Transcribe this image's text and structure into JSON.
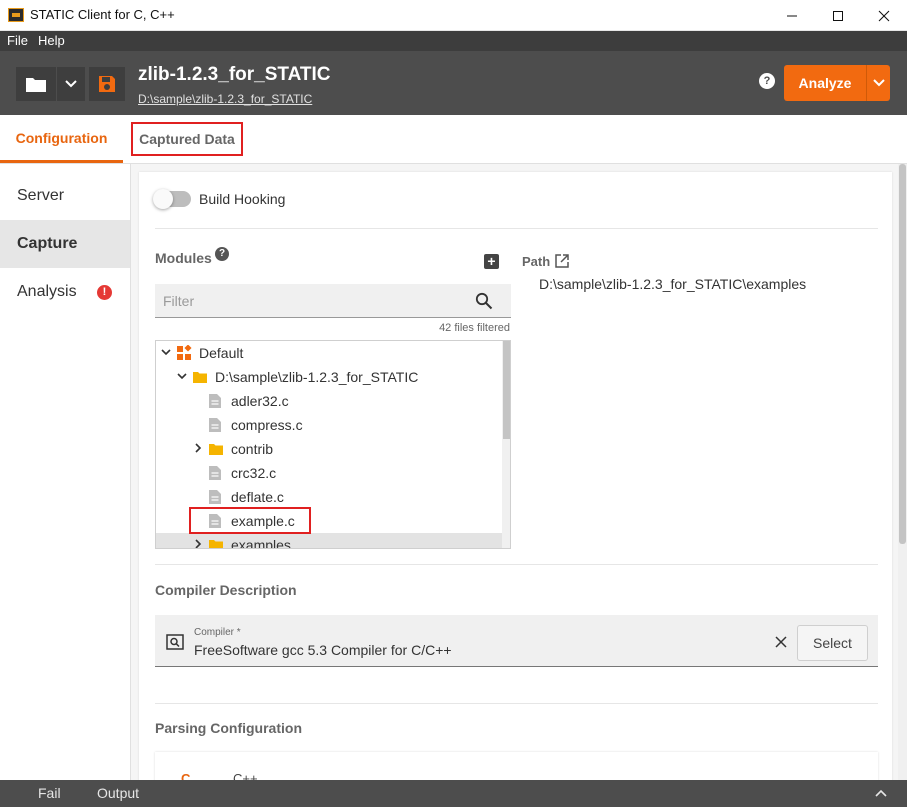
{
  "window": {
    "title": "STATIC Client for C, C++"
  },
  "menu": {
    "file": "File",
    "help": "Help"
  },
  "header": {
    "project_title": "zlib-1.2.3_for_STATIC",
    "project_path": "D:\\sample\\zlib-1.2.3_for_STATIC",
    "help_icon": "?",
    "analyze_label": "Analyze"
  },
  "tabs": [
    {
      "label": "Configuration",
      "active": true
    },
    {
      "label": "Captured Data",
      "active": false,
      "highlighted": true
    }
  ],
  "sidebar": {
    "items": [
      {
        "label": "Server"
      },
      {
        "label": "Capture",
        "active": true
      },
      {
        "label": "Analysis",
        "badge": "!"
      }
    ]
  },
  "capture": {
    "build_hooking_label": "Build Hooking",
    "build_hooking_on": false,
    "modules_label": "Modules",
    "modules_help": "?",
    "add_icon": "+",
    "filter_placeholder": "Filter",
    "filter_value": "",
    "files_filtered": "42 files filtered",
    "tree": [
      {
        "label": "Default",
        "type": "module",
        "expanded": true
      },
      {
        "label": "D:\\sample\\zlib-1.2.3_for_STATIC",
        "type": "folder",
        "expanded": true
      },
      {
        "label": "adler32.c",
        "type": "file"
      },
      {
        "label": "compress.c",
        "type": "file"
      },
      {
        "label": "contrib",
        "type": "folder",
        "expanded": false
      },
      {
        "label": "crc32.c",
        "type": "file"
      },
      {
        "label": "deflate.c",
        "type": "file"
      },
      {
        "label": "example.c",
        "type": "file",
        "highlighted": true
      },
      {
        "label": "examples",
        "type": "folder",
        "expanded": false
      }
    ],
    "path_label": "Path",
    "path_value": "D:\\sample\\zlib-1.2.3_for_STATIC\\examples"
  },
  "compiler": {
    "section_label": "Compiler Description",
    "field_label": "Compiler *",
    "value": "FreeSoftware gcc 5.3 Compiler for C/C++",
    "select_label": "Select"
  },
  "parsing": {
    "section_label": "Parsing Configuration",
    "language_short": "C",
    "language_name": "C++"
  },
  "bottom": {
    "fail": "Fail",
    "output": "Output"
  },
  "colors": {
    "accent": "#f26a10",
    "header_bg": "#4d4d4d",
    "highlight_border": "#e02020",
    "error": "#e53935",
    "folder": "#f5b400"
  }
}
